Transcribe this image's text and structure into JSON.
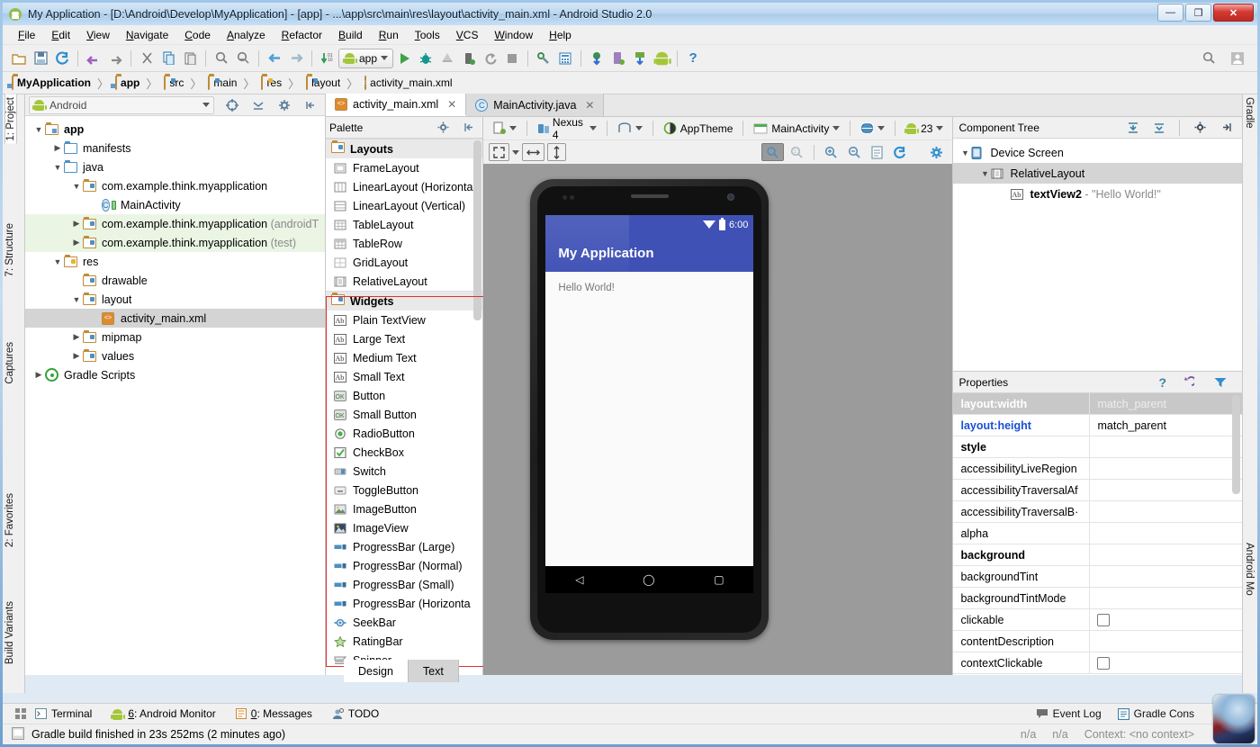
{
  "window": {
    "title": "My Application - [D:\\Android\\Develop\\MyApplication] - [app] - ...\\app\\src\\main\\res\\layout\\activity_main.xml - Android Studio 2.0",
    "minimize": "—",
    "maximize": "❐",
    "close": "✕"
  },
  "menu": [
    "File",
    "Edit",
    "View",
    "Navigate",
    "Code",
    "Analyze",
    "Refactor",
    "Build",
    "Run",
    "Tools",
    "VCS",
    "Window",
    "Help"
  ],
  "toolbar": {
    "run_config": "app",
    "icons": [
      "open-folder-icon",
      "save-all-icon",
      "sync-icon",
      "undo-icon",
      "redo-icon",
      "cut-icon",
      "copy-icon",
      "paste-icon",
      "find-icon",
      "find-replace-icon",
      "back-icon",
      "forward-icon",
      "update-project-icon",
      "run-icon",
      "debug-icon",
      "coverage-icon",
      "attach-debugger-icon",
      "rerun-icon",
      "stop-icon",
      "sdk-manager-icon",
      "avd-manager-icon",
      "download-icon",
      "device-monitor-icon",
      "sdk-update-icon",
      "android-icon",
      "help-icon",
      "search-everywhere-icon",
      "user-icon"
    ]
  },
  "breadcrumb": [
    {
      "label": "MyApplication",
      "icon": "module-icon",
      "bold": true
    },
    {
      "label": "app",
      "icon": "module-icon",
      "bold": true
    },
    {
      "label": "src",
      "icon": "folder-icon",
      "bold": false
    },
    {
      "label": "main",
      "icon": "folder-icon",
      "bold": false
    },
    {
      "label": "res",
      "icon": "res-folder-icon",
      "bold": false
    },
    {
      "label": "layout",
      "icon": "package-folder-icon",
      "bold": false
    },
    {
      "label": "activity_main.xml",
      "icon": "xml-file-icon",
      "bold": false
    }
  ],
  "left_tool_tabs": [
    {
      "label": "1: Project",
      "selected": true
    },
    {
      "label": "7: Structure",
      "selected": false
    },
    {
      "label": "Captures",
      "selected": false
    },
    {
      "label": "2: Favorites",
      "selected": false
    },
    {
      "label": "Build Variants",
      "selected": false
    }
  ],
  "right_tool_tabs": [
    {
      "label": "Gradle"
    },
    {
      "label": "Android Mo"
    }
  ],
  "project_panel": {
    "view_selector": "Android",
    "header_icons": [
      "target-icon",
      "collapse-all-icon",
      "settings-icon",
      "hide-icon"
    ],
    "tree": [
      {
        "indent": 0,
        "arrow": "▼",
        "icon": "module-icon",
        "label": "app",
        "bold": true,
        "dim": "",
        "selected": false,
        "green": false
      },
      {
        "indent": 1,
        "arrow": "▶",
        "icon": "folder-blue",
        "label": "manifests",
        "bold": false,
        "dim": "",
        "selected": false,
        "green": false
      },
      {
        "indent": 1,
        "arrow": "▼",
        "icon": "folder-blue",
        "label": "java",
        "bold": false,
        "dim": "",
        "selected": false,
        "green": false
      },
      {
        "indent": 2,
        "arrow": "▼",
        "icon": "package-icon",
        "label": "com.example.think.myapplication",
        "bold": false,
        "dim": "",
        "selected": false,
        "green": false
      },
      {
        "indent": 3,
        "arrow": "",
        "icon": "class-icon",
        "label": "MainActivity",
        "bold": false,
        "dim": "",
        "selected": false,
        "green": false
      },
      {
        "indent": 2,
        "arrow": "▶",
        "icon": "package-icon",
        "label": "com.example.think.myapplication",
        "bold": false,
        "dim": "(androidT",
        "selected": false,
        "green": true
      },
      {
        "indent": 2,
        "arrow": "▶",
        "icon": "package-icon",
        "label": "com.example.think.myapplication",
        "bold": false,
        "dim": "(test)",
        "selected": false,
        "green": true
      },
      {
        "indent": 1,
        "arrow": "▼",
        "icon": "res-folder",
        "label": "res",
        "bold": false,
        "dim": "",
        "selected": false,
        "green": false
      },
      {
        "indent": 2,
        "arrow": "",
        "icon": "package-icon",
        "label": "drawable",
        "bold": false,
        "dim": "",
        "selected": false,
        "green": false
      },
      {
        "indent": 2,
        "arrow": "▼",
        "icon": "package-icon",
        "label": "layout",
        "bold": false,
        "dim": "",
        "selected": false,
        "green": false
      },
      {
        "indent": 3,
        "arrow": "",
        "icon": "xml-file-icon",
        "label": "activity_main.xml",
        "bold": false,
        "dim": "",
        "selected": true,
        "green": false
      },
      {
        "indent": 2,
        "arrow": "▶",
        "icon": "package-icon",
        "label": "mipmap",
        "bold": false,
        "dim": "",
        "selected": false,
        "green": false
      },
      {
        "indent": 2,
        "arrow": "▶",
        "icon": "package-icon",
        "label": "values",
        "bold": false,
        "dim": "",
        "selected": false,
        "green": false
      },
      {
        "indent": 0,
        "arrow": "▶",
        "icon": "gradle-icon",
        "label": "Gradle Scripts",
        "bold": false,
        "dim": "",
        "selected": false,
        "green": false
      }
    ]
  },
  "editor_tabs": [
    {
      "label": "activity_main.xml",
      "icon": "xml-file-icon",
      "active": true,
      "close": "✕"
    },
    {
      "label": "MainActivity.java",
      "icon": "class-icon",
      "active": false,
      "close": "✕"
    }
  ],
  "palette": {
    "title": "Palette",
    "groups": [
      {
        "name": "Layouts",
        "items": [
          {
            "label": "FrameLayout",
            "icon": "frame-layout-icon"
          },
          {
            "label": "LinearLayout (Horizontа",
            "icon": "linear-horizontal-icon"
          },
          {
            "label": "LinearLayout (Vertical)",
            "icon": "linear-vertical-icon"
          },
          {
            "label": "TableLayout",
            "icon": "table-layout-icon"
          },
          {
            "label": "TableRow",
            "icon": "table-row-icon"
          },
          {
            "label": "GridLayout",
            "icon": "grid-layout-icon"
          },
          {
            "label": "RelativeLayout",
            "icon": "relative-layout-icon"
          }
        ]
      },
      {
        "name": "Widgets",
        "items": [
          {
            "label": "Plain TextView",
            "icon": "textview-icon"
          },
          {
            "label": "Large Text",
            "icon": "textview-icon"
          },
          {
            "label": "Medium Text",
            "icon": "textview-icon"
          },
          {
            "label": "Small Text",
            "icon": "textview-icon"
          },
          {
            "label": "Button",
            "icon": "button-icon"
          },
          {
            "label": "Small Button",
            "icon": "button-icon"
          },
          {
            "label": "RadioButton",
            "icon": "radio-icon"
          },
          {
            "label": "CheckBox",
            "icon": "checkbox-icon"
          },
          {
            "label": "Switch",
            "icon": "switch-icon"
          },
          {
            "label": "ToggleButton",
            "icon": "toggle-icon"
          },
          {
            "label": "ImageButton",
            "icon": "image-button-icon"
          },
          {
            "label": "ImageView",
            "icon": "image-view-icon"
          },
          {
            "label": "ProgressBar (Large)",
            "icon": "progressbar-icon"
          },
          {
            "label": "ProgressBar (Normal)",
            "icon": "progressbar-icon"
          },
          {
            "label": "ProgressBar (Small)",
            "icon": "progressbar-icon"
          },
          {
            "label": "ProgressBar (Horizonta",
            "icon": "progressbar-icon"
          },
          {
            "label": "SeekBar",
            "icon": "seekbar-icon"
          },
          {
            "label": "RatingBar",
            "icon": "ratingbar-icon"
          },
          {
            "label": "Spinner",
            "icon": "spinner-icon"
          }
        ]
      }
    ]
  },
  "design_toolbar": {
    "device": "Nexus 4",
    "orientation_icon": "orientation-icon",
    "theme": "AppTheme",
    "activity": "MainActivity",
    "locale_icon": "globe-icon",
    "api_level": "23",
    "zoom_fit_icon": "zoom-fit-icon",
    "zoom_width_icon": "fit-width-icon",
    "zoom_height_icon": "fit-height-icon",
    "pan_icon": "pan-icon",
    "zoom_actual_icon": "zoom-1-1-icon",
    "zoom_in_icon": "zoom-in-icon",
    "zoom_out_icon": "zoom-out-icon",
    "file_icon": "file-icon",
    "refresh_icon": "refresh-icon",
    "settings_icon": "gear-icon"
  },
  "preview": {
    "status_time": "6:00",
    "app_title": "My Application",
    "content_text": "Hello World!",
    "nav_back": "◁",
    "nav_home": "◯",
    "nav_recent": "▢",
    "accent_color": "#3f51b5"
  },
  "component_tree": {
    "title": "Component Tree",
    "header_icons": [
      "expand-all-icon",
      "collapse-all-icon",
      "gear-icon",
      "hide-icon"
    ],
    "nodes": [
      {
        "indent": 0,
        "arrow": "▼",
        "icon": "device-screen-icon",
        "label": "Device Screen",
        "detail": "",
        "bold": false,
        "selected": false
      },
      {
        "indent": 1,
        "arrow": "▼",
        "icon": "relative-layout-icon",
        "label": "RelativeLayout",
        "detail": "",
        "bold": false,
        "selected": true
      },
      {
        "indent": 2,
        "arrow": "",
        "icon": "textview-icon",
        "label": "textView2",
        "detail": "- \"Hello World!\"",
        "bold": true,
        "selected": false
      }
    ]
  },
  "properties": {
    "title": "Properties",
    "header_icons": [
      "help-icon",
      "restore-icon",
      "filter-icon"
    ],
    "rows": [
      {
        "name": "layout:width",
        "value": "match_parent",
        "style": "selected",
        "checkbox": false
      },
      {
        "name": "layout:height",
        "value": "match_parent",
        "style": "blue",
        "checkbox": false
      },
      {
        "name": "style",
        "value": "",
        "style": "bold",
        "checkbox": false
      },
      {
        "name": "accessibilityLiveRegion",
        "value": "",
        "style": "normal",
        "checkbox": false
      },
      {
        "name": "accessibilityTraversalAf",
        "value": "",
        "style": "normal",
        "checkbox": false
      },
      {
        "name": "accessibilityTraversalB·",
        "value": "",
        "style": "normal",
        "checkbox": false
      },
      {
        "name": "alpha",
        "value": "",
        "style": "normal",
        "checkbox": false
      },
      {
        "name": "background",
        "value": "",
        "style": "bold",
        "checkbox": false
      },
      {
        "name": "backgroundTint",
        "value": "",
        "style": "normal",
        "checkbox": false
      },
      {
        "name": "backgroundTintMode",
        "value": "",
        "style": "normal",
        "checkbox": false
      },
      {
        "name": "clickable",
        "value": "",
        "style": "normal",
        "checkbox": true
      },
      {
        "name": "contentDescription",
        "value": "",
        "style": "normal",
        "checkbox": false
      },
      {
        "name": "contextClickable",
        "value": "",
        "style": "normal",
        "checkbox": true
      }
    ]
  },
  "design_text_tabs": [
    {
      "label": "Design",
      "active": true
    },
    {
      "label": "Text",
      "active": false
    }
  ],
  "tool_windows": [
    {
      "label": "Terminal",
      "mnemonic": "",
      "icon": "terminal-icon"
    },
    {
      "label": ": Android Monitor",
      "mnemonic": "6",
      "icon": "android-monitor-icon"
    },
    {
      "label": ": Messages",
      "mnemonic": "0",
      "icon": "messages-icon"
    },
    {
      "label": "TODO",
      "mnemonic": "",
      "icon": "todo-icon"
    }
  ],
  "status_bar": {
    "message": "Gradle build finished in 23s 252ms (2 minutes ago)",
    "event_log": "Event Log",
    "gradle_console": "Gradle Cons",
    "indicator_1": "n/a",
    "indicator_2": "n/a",
    "context": "Context: <no context>"
  }
}
